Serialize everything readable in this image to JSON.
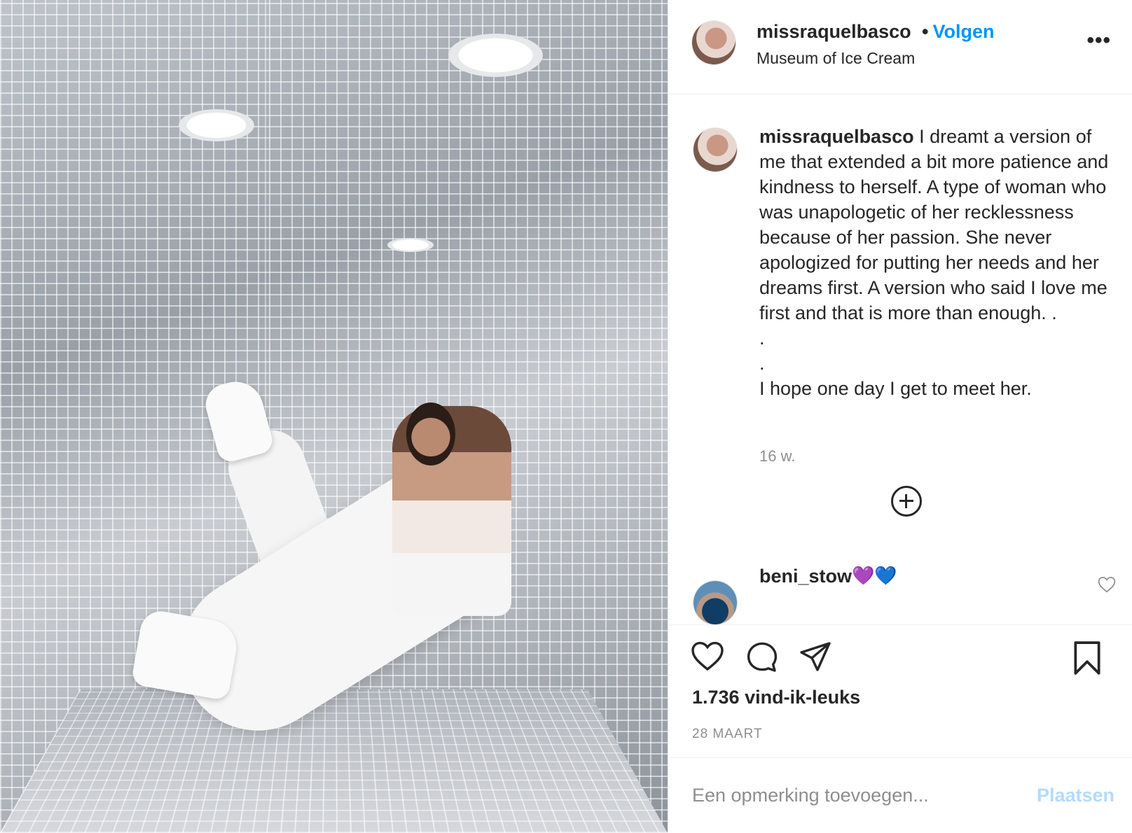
{
  "post": {
    "photo_alt": "",
    "author": {
      "username": "missraquelbasco",
      "avatar_icon": "user-avatar"
    },
    "header": {
      "separator": "•",
      "follow_label": "Volgen",
      "location": "Museum of Ice Cream",
      "more_label": "•••"
    },
    "caption": {
      "username": "missraquelbasco",
      "text": " I dreamt a version of me that extended a bit more patience and kindness to herself. A type of woman who was unapologetic of her recklessness because of her passion. She never apologized for putting her needs and her dreams first. A version who said I love me first and that is more than enough. .\n.\n.\nI hope one day I get to meet her.",
      "time_ago": "16 w."
    },
    "load_more_icon": "plus-circle-icon",
    "comments": [
      {
        "username": "beni_stow",
        "text_emoji_1": "💜",
        "text_emoji_2": "💙"
      }
    ],
    "actions": {
      "like_icon": "heart-icon",
      "comment_icon": "comment-icon",
      "share_icon": "paper-plane-icon",
      "save_icon": "bookmark-icon"
    },
    "likes_text": "1.736 vind-ik-leuks",
    "date_text": "28 MAART",
    "composer": {
      "placeholder": "Een opmerking toevoegen...",
      "post_label": "Plaatsen"
    },
    "colors": {
      "follow_blue": "#0095f6",
      "post_disabled_blue": "#b3dbff",
      "muted_text": "#8e8e8e"
    }
  }
}
